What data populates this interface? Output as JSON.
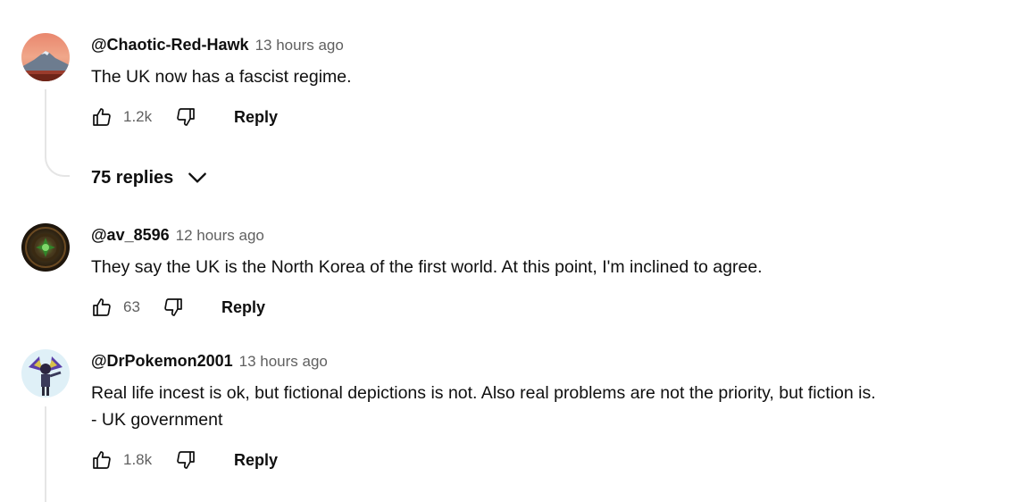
{
  "comments": [
    {
      "author": "@Chaotic-Red-Hawk",
      "time": "13 hours ago",
      "lines": [
        "The UK now has a fascist regime."
      ],
      "likes": "1.2k",
      "reply_label": "Reply",
      "replies_label": "75 replies",
      "avatar": "mountain-sunset-avatar"
    },
    {
      "author": "@av_8596",
      "time": "12 hours ago",
      "lines": [
        "They say the UK is the North Korea of the first world. At this point, I'm inclined to agree."
      ],
      "likes": "63",
      "reply_label": "Reply",
      "avatar": "dark-green-glow-avatar"
    },
    {
      "author": "@DrPokemon2001",
      "time": "13 hours ago",
      "lines": [
        "Real life incest is ok, but fictional depictions is not. Also real problems are not the priority, but fiction is.",
        "- UK government"
      ],
      "likes": "1.8k",
      "reply_label": "Reply",
      "avatar": "purple-character-avatar"
    }
  ],
  "icons": {
    "like": "thumbs-up-icon",
    "dislike": "thumbs-down-icon",
    "expand": "chevron-down-icon"
  }
}
